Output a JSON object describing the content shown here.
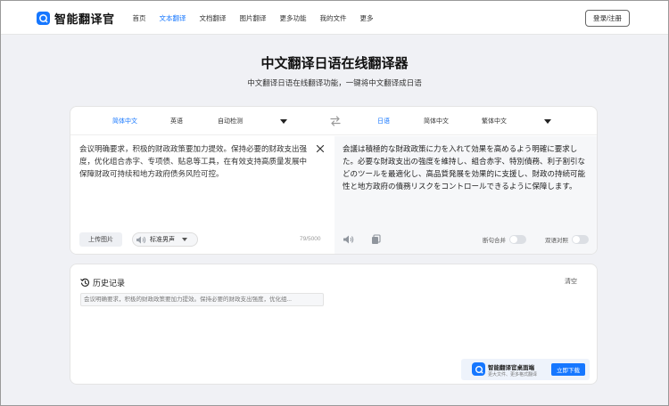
{
  "brand": {
    "name": "智能翻译官",
    "accent": "#1677ff"
  },
  "nav": {
    "items": [
      {
        "label": "首页"
      },
      {
        "label": "文本翻译",
        "active": true
      },
      {
        "label": "文档翻译"
      },
      {
        "label": "图片翻译"
      },
      {
        "label": "更多功能"
      },
      {
        "label": "我的文件"
      },
      {
        "label": "更多"
      }
    ],
    "login_label": "登录/注册"
  },
  "hero": {
    "title": "中文翻译日语在线翻译器",
    "subtitle": "中文翻译日语在线翻译功能，一键将中文翻译成日语"
  },
  "translator": {
    "source_langs": [
      "简体中文",
      "英语",
      "自动检测"
    ],
    "target_langs": [
      "日语",
      "简体中文",
      "繁体中文"
    ],
    "source_text": "会议明确要求，积极的财政政策要加力提效。保持必要的财政支出强度，优化组合赤字、专项债、贴息等工具，在有效支持高质量发展中保障财政可持续和地方政府债务风险可控。",
    "target_text": "会議は積極的な財政政策に力を入れて効果を高めるよう明確に要求した。必要な財政支出の強度を維持し、組合赤字、特別債務、利子割引などのツールを最適化し、高品質発展を効果的に支援し、財政の持続可能性と地方政府の債務リスクをコントロールできるように保障します。",
    "upload_label": "上传图片",
    "voice_label": "标准男声",
    "char_count": "79/5000",
    "toggle_sentence": "断句合并",
    "toggle_bilingual": "双语对照"
  },
  "history": {
    "title": "历史记录",
    "clear_label": "清空",
    "items": [
      "会议明确要求，积极的财政政策要加力提效。保持必要的财政支出强度，优化组..."
    ]
  },
  "promo": {
    "title": "智能翻译官桌面端",
    "subtitle": "更大文件、更多格式翻译",
    "button": "立即下载"
  }
}
